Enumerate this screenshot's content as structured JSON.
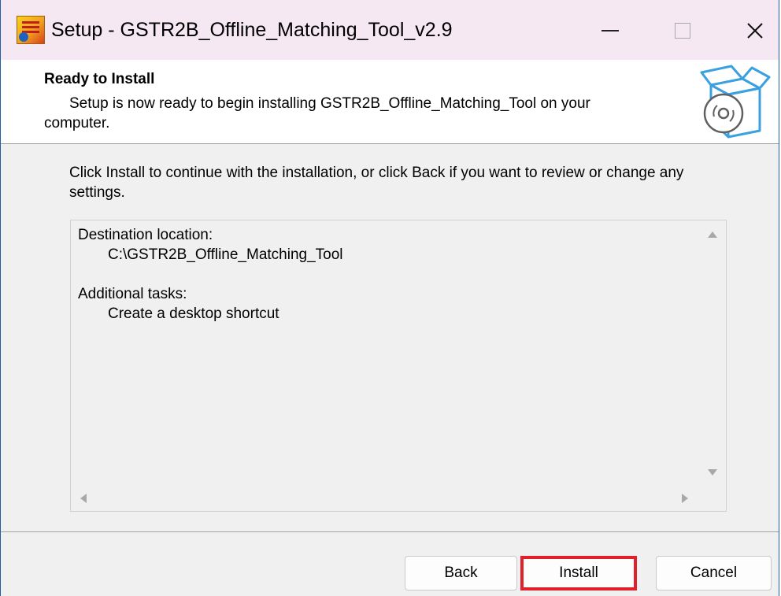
{
  "window": {
    "title": "Setup - GSTR2B_Offline_Matching_Tool_v2.9",
    "app_icon": "app-logo-icon",
    "controls": [
      "minimize-icon",
      "maximize-icon",
      "close-icon"
    ]
  },
  "header": {
    "title": "Ready to Install",
    "subtitle_line1": "Setup is now ready to begin installing GSTR2B_Offline_Matching_Tool on your",
    "subtitle_line2": "computer.",
    "icon": "install-box-icon"
  },
  "intro": "Click Install to continue with the installation, or click Back if you want to review or change any settings.",
  "memo": {
    "destination_label": "Destination location:",
    "destination_value": "C:\\GSTR2B_Offline_Matching_Tool",
    "tasks_label": "Additional tasks:",
    "tasks_value": "Create a desktop shortcut"
  },
  "buttons": {
    "back": "Back",
    "install": "Install",
    "cancel": "Cancel"
  },
  "colors": {
    "title_bar": "#f5e8f2",
    "highlight": "#e0212b",
    "box_icon": "#3aa0e0"
  }
}
